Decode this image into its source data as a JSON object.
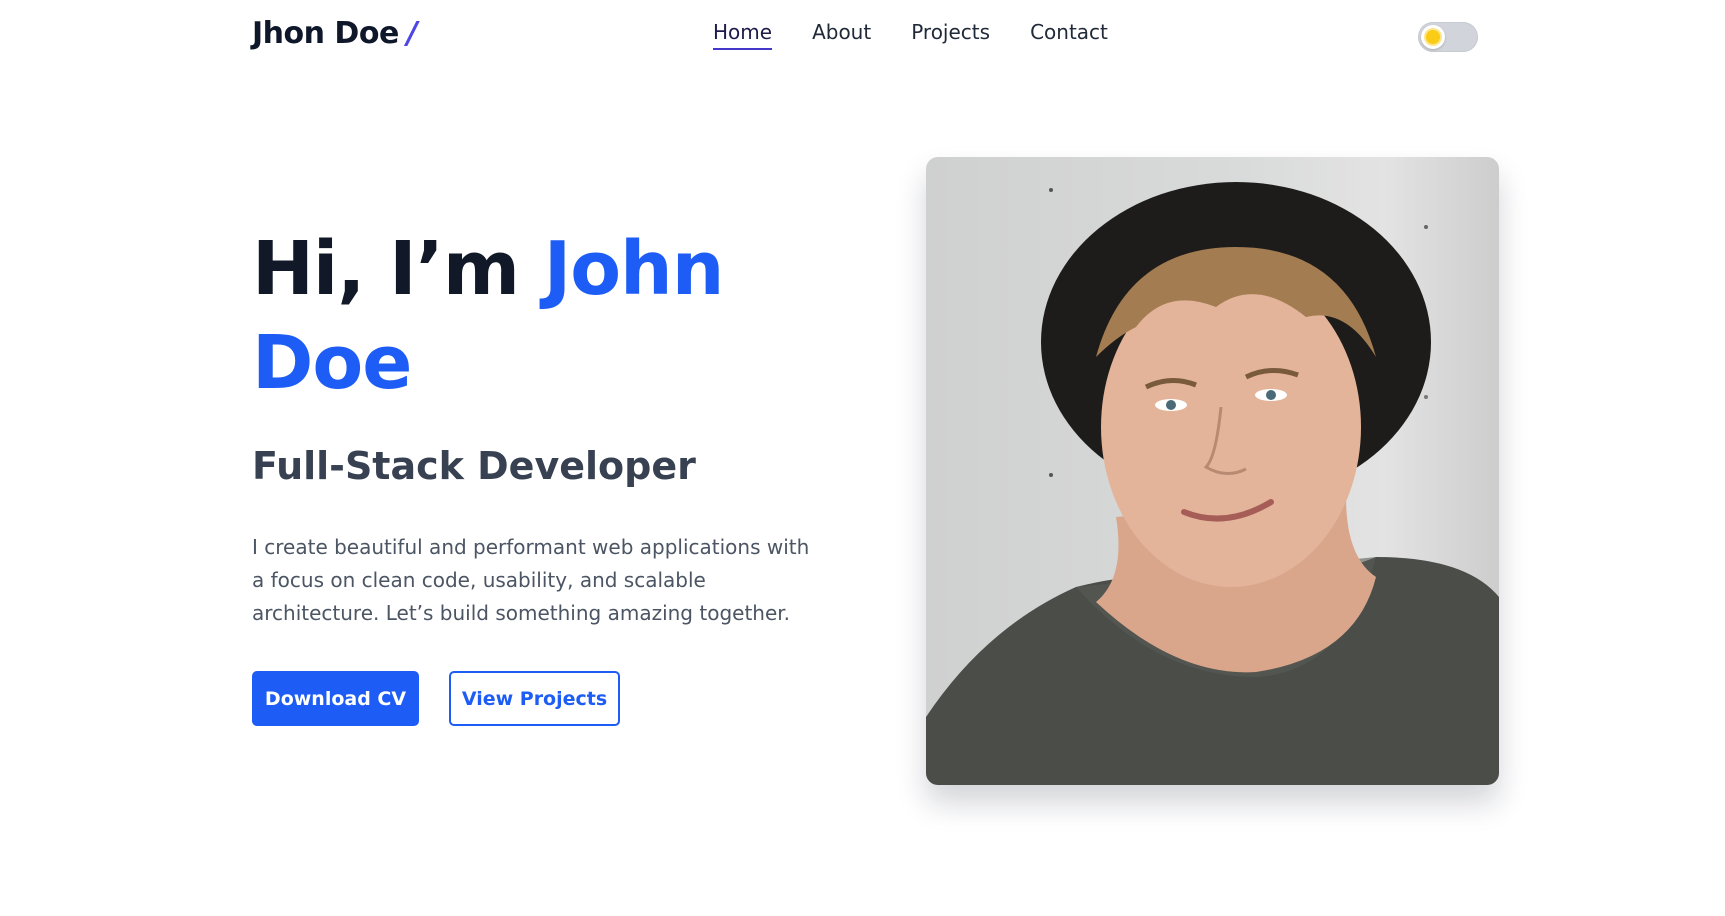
{
  "header": {
    "logo_text": "Jhon Doe",
    "logo_mark": "/",
    "nav": [
      {
        "label": "Home",
        "active": true
      },
      {
        "label": "About",
        "active": false
      },
      {
        "label": "Projects",
        "active": false
      },
      {
        "label": "Contact",
        "active": false
      }
    ],
    "theme_toggle_icon": "sun-icon"
  },
  "hero": {
    "greeting": "Hi, I’m ",
    "name": "John Doe",
    "role": "Full-Stack Developer",
    "description": "I create beautiful and performant web applications with a focus on clean code, usability, and scalable architecture. Let’s build something amazing together.",
    "primary_button": "Download CV",
    "secondary_button": "View Projects"
  },
  "colors": {
    "accent": "#1d5cf5",
    "logo_mark": "#4f46e5",
    "heading": "#0f172a",
    "body_text": "#4b5563"
  }
}
